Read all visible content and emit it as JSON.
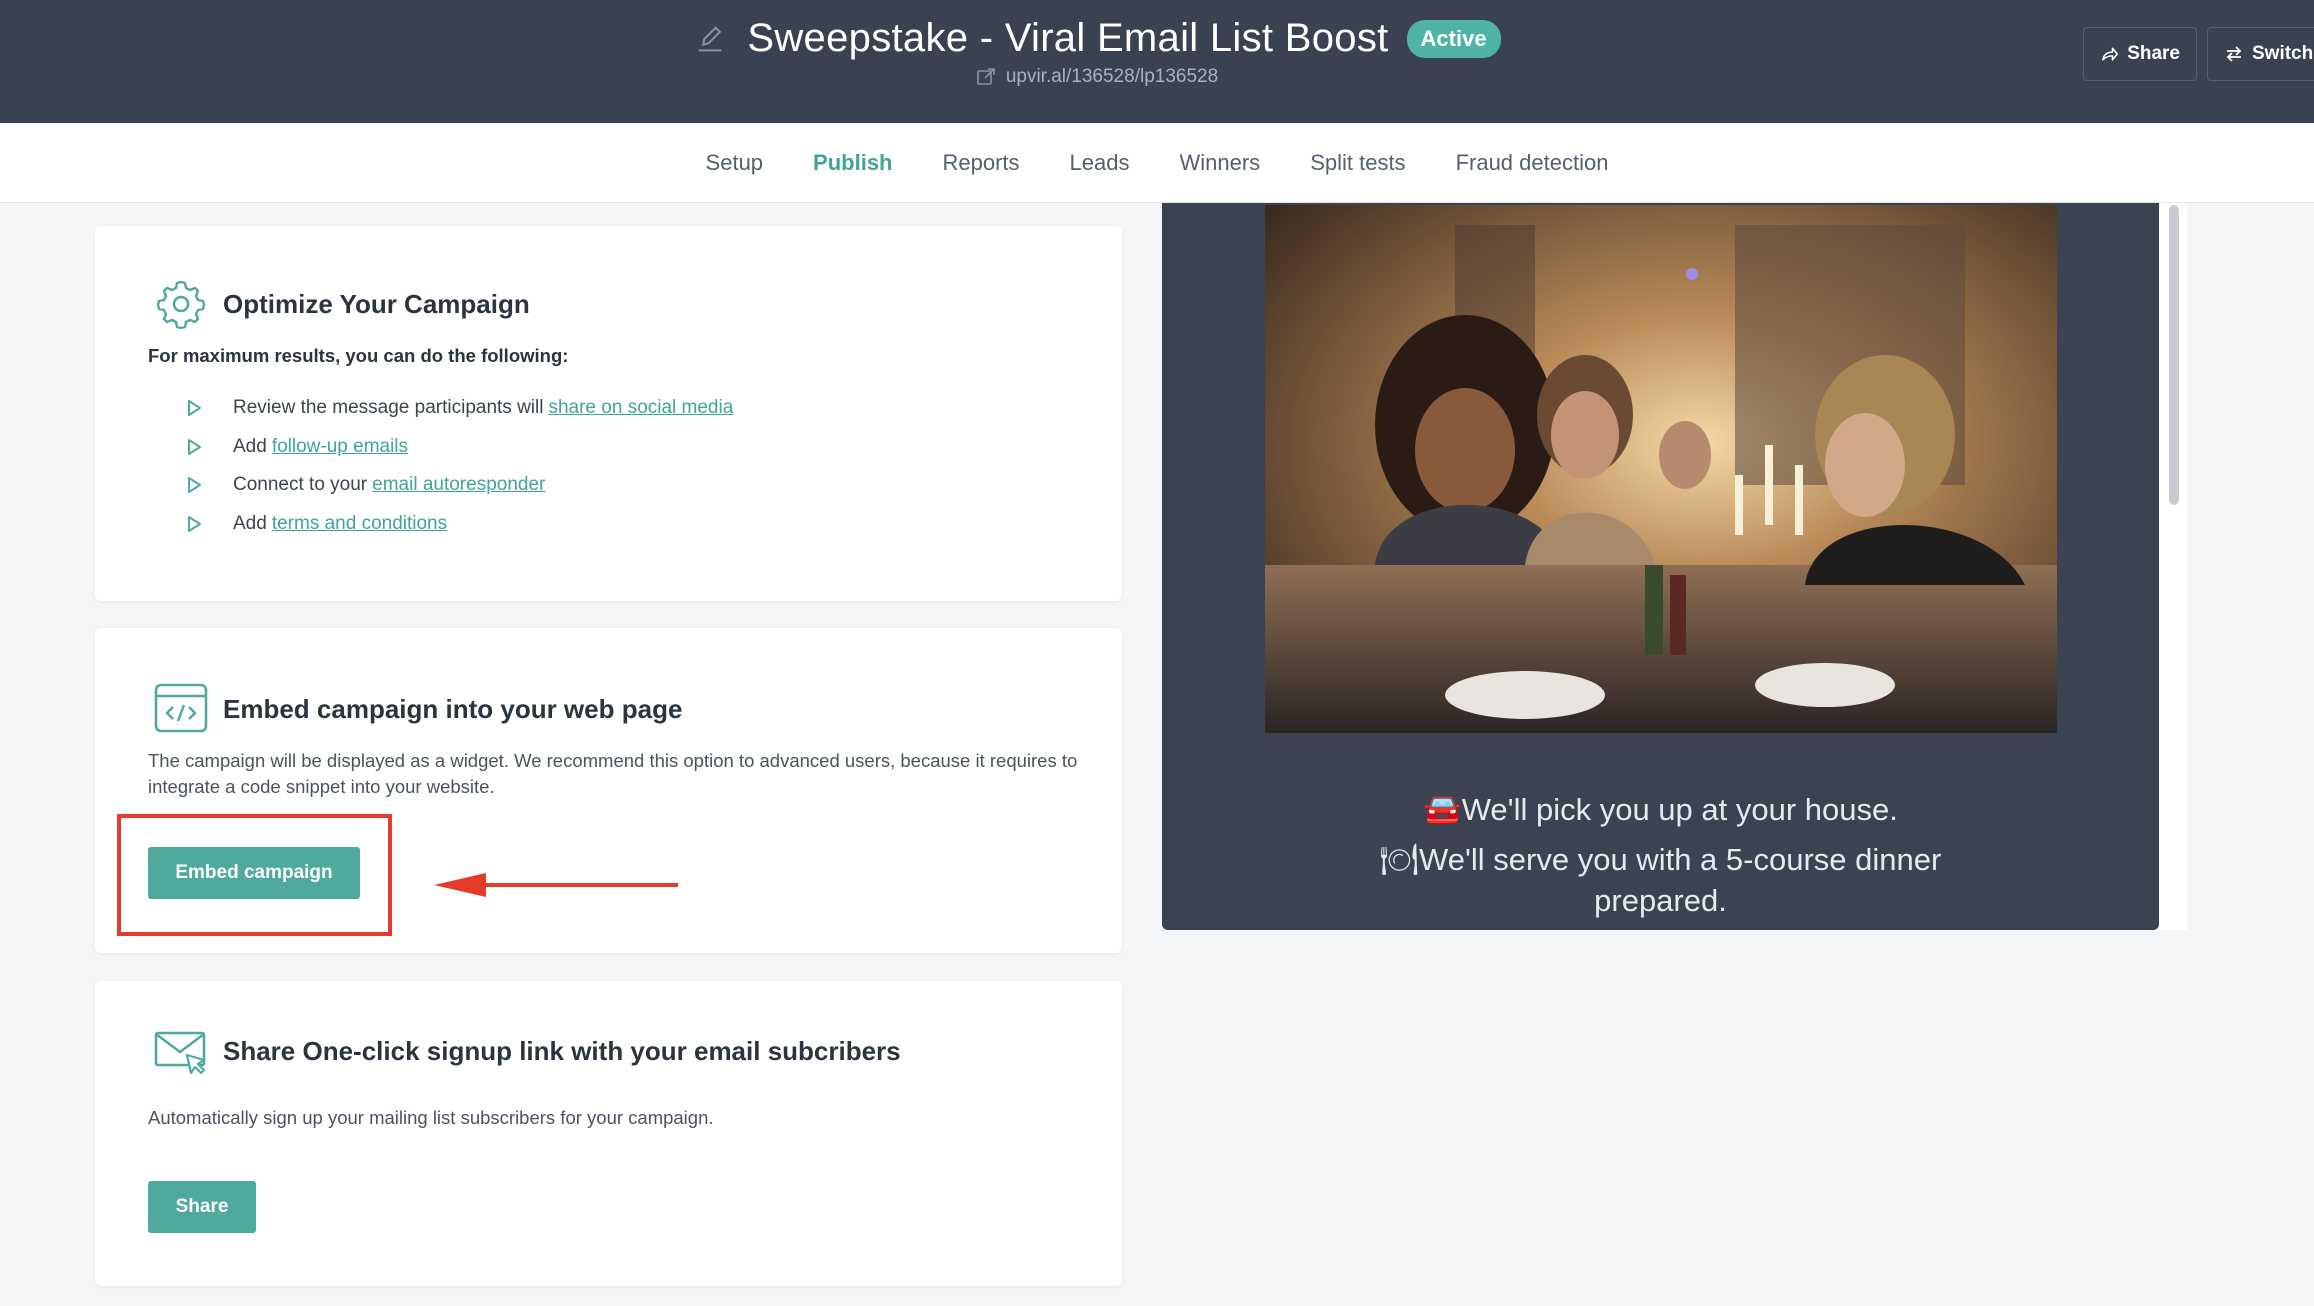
{
  "header": {
    "campaign_title": "Sweepstake - Viral Email List Boost",
    "status": "Active",
    "url": "upvir.al/136528/lp136528",
    "share_label": "Share",
    "switch_label": "Switch"
  },
  "tabs": [
    {
      "label": "Setup",
      "active": false
    },
    {
      "label": "Publish",
      "active": true
    },
    {
      "label": "Reports",
      "active": false
    },
    {
      "label": "Leads",
      "active": false
    },
    {
      "label": "Winners",
      "active": false
    },
    {
      "label": "Split tests",
      "active": false
    },
    {
      "label": "Fraud detection",
      "active": false
    }
  ],
  "optimize": {
    "title": "Optimize Your Campaign",
    "subtitle": "For maximum results, you can do the following:",
    "tips": [
      {
        "prefix": "Review the message participants will",
        "link": "share on social media"
      },
      {
        "prefix": "Add",
        "link": "follow-up emails"
      },
      {
        "prefix": "Connect to your",
        "link": "email autoresponder"
      },
      {
        "prefix": "Add",
        "link": "terms and conditions"
      }
    ]
  },
  "embed": {
    "title": "Embed campaign into your web page",
    "description": "The campaign will be displayed as a widget. We recommend this option to advanced users, because it requires to integrate a code snippet into your website.",
    "button_label": "Embed campaign"
  },
  "share_signup": {
    "title": "Share One-click signup link with your email subcribers",
    "description": "Automatically sign up your mailing list subscribers for your campaign.",
    "button_label": "Share"
  },
  "preview": {
    "line1": "🚘We'll pick you up at your house.",
    "line2": "🍽We'll serve you with a 5-course dinner",
    "line3": "prepared."
  },
  "colors": {
    "header_bg": "#3a4252",
    "accent": "#4fa99d",
    "status_badge": "#4fb3a5",
    "highlight": "#e53b2c"
  }
}
